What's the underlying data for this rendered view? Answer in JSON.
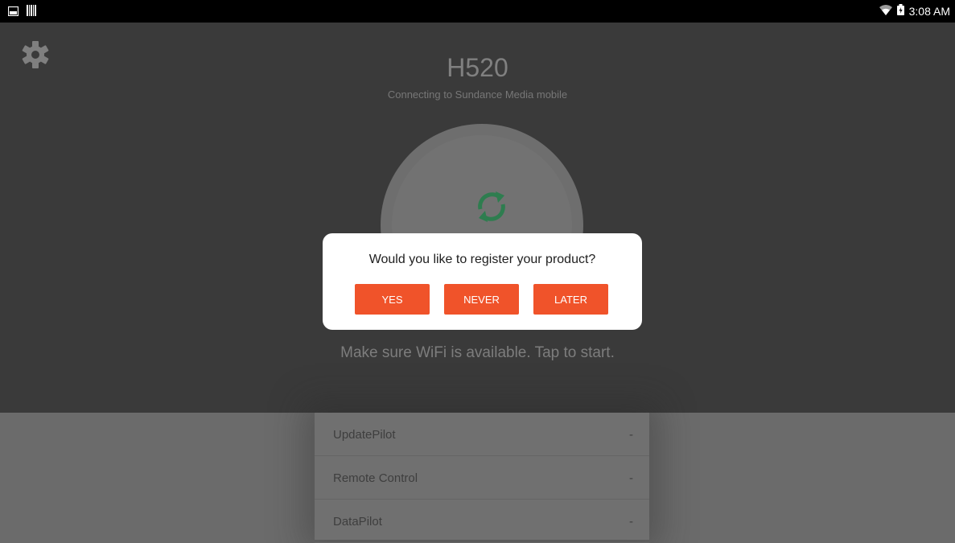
{
  "status_bar": {
    "time": "3:08 AM",
    "icons": [
      "image-icon",
      "barcode-icon",
      "wifi-icon",
      "battery-icon"
    ]
  },
  "header": {
    "title": "H520",
    "subtitle": "Connecting to Sundance Media mobile",
    "hint": "Make sure WiFi is available. Tap to start."
  },
  "dialog": {
    "message": "Would you like to register your product?",
    "yes_label": "YES",
    "never_label": "NEVER",
    "later_label": "LATER"
  },
  "list": {
    "items": [
      {
        "label": "UpdatePilot",
        "value": "-"
      },
      {
        "label": "Remote Control",
        "value": "-"
      },
      {
        "label": "DataPilot",
        "value": "-"
      }
    ]
  },
  "colors": {
    "accent": "#f0532a",
    "refresh": "#2e7d4f",
    "background_dark": "#3a3a3a"
  }
}
